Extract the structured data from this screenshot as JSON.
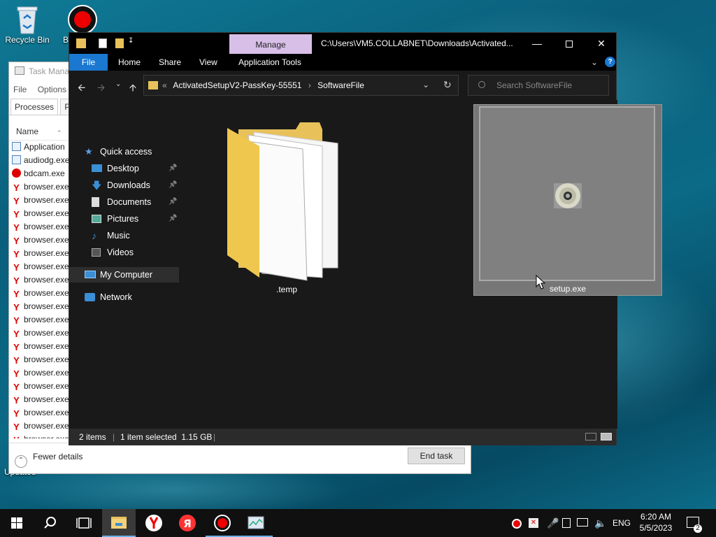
{
  "desktop": {
    "icons": [
      {
        "label": "Recycle Bin"
      },
      {
        "label": "B"
      }
    ],
    "bottom_text": "Updated"
  },
  "task_manager": {
    "title": "Task Manag",
    "menu": [
      "File",
      "Options"
    ],
    "tabs": [
      "Processes",
      "Pe"
    ],
    "column_name": "Name",
    "rows": [
      {
        "name": "Application",
        "icon": "app-icon"
      },
      {
        "name": "audiodg.exe",
        "icon": "app-icon"
      },
      {
        "name": "bdcam.exe",
        "icon": "record-icon"
      },
      {
        "name": "browser.exe",
        "icon": "yandex-icon"
      },
      {
        "name": "browser.exe",
        "icon": "yandex-icon"
      },
      {
        "name": "browser.exe",
        "icon": "yandex-icon"
      },
      {
        "name": "browser.exe",
        "icon": "yandex-icon"
      },
      {
        "name": "browser.exe",
        "icon": "yandex-icon"
      },
      {
        "name": "browser.exe",
        "icon": "yandex-icon"
      },
      {
        "name": "browser.exe",
        "icon": "yandex-icon"
      },
      {
        "name": "browser.exe",
        "icon": "yandex-icon"
      },
      {
        "name": "browser.exe",
        "icon": "yandex-icon"
      },
      {
        "name": "browser.exe",
        "icon": "yandex-icon"
      },
      {
        "name": "browser.exe",
        "icon": "yandex-icon"
      },
      {
        "name": "browser.exe",
        "icon": "yandex-icon"
      },
      {
        "name": "browser.exe",
        "icon": "yandex-icon"
      },
      {
        "name": "browser.exe",
        "icon": "yandex-icon"
      },
      {
        "name": "browser.exe",
        "icon": "yandex-icon"
      },
      {
        "name": "browser.exe",
        "icon": "yandex-icon"
      },
      {
        "name": "browser.exe",
        "icon": "yandex-icon"
      },
      {
        "name": "browser.exe",
        "icon": "yandex-icon"
      },
      {
        "name": "browser.exe",
        "icon": "yandex-icon"
      },
      {
        "name": "browser.exe",
        "icon": "yandex-icon"
      }
    ],
    "fewer_details": "Fewer details",
    "end_task": "End task"
  },
  "explorer": {
    "manage_tab": "Manage",
    "title_path": "C:\\Users\\VM5.COLLABNET\\Downloads\\Activated...",
    "ribbon": [
      "File",
      "Home",
      "Share",
      "View",
      "Application Tools"
    ],
    "address": {
      "prefix": "«",
      "crumbs": [
        "ActivatedSetupV2-PassKey-55551",
        "SoftwareFile"
      ]
    },
    "search_placeholder": "Search SoftwareFile",
    "nav": [
      {
        "label": "Quick access",
        "icon": "star-icon",
        "pinned": false
      },
      {
        "label": "Desktop",
        "icon": "desktop-icon",
        "pinned": true
      },
      {
        "label": "Downloads",
        "icon": "download-icon",
        "pinned": true
      },
      {
        "label": "Documents",
        "icon": "documents-icon",
        "pinned": true
      },
      {
        "label": "Pictures",
        "icon": "pictures-icon",
        "pinned": true
      },
      {
        "label": "Music",
        "icon": "music-icon",
        "pinned": false
      },
      {
        "label": "Videos",
        "icon": "videos-icon",
        "pinned": false
      },
      {
        "label": "My Computer",
        "icon": "computer-icon",
        "pinned": false
      },
      {
        "label": "Network",
        "icon": "network-icon",
        "pinned": false
      }
    ],
    "items": [
      {
        "name": ".temp",
        "icon": "folder-icon"
      },
      {
        "name": "setup.exe",
        "icon": "disc-icon"
      }
    ],
    "status": {
      "count": "2 items",
      "selection": "1 item selected  1.15 GB"
    }
  },
  "taskbar": {
    "language": "ENG",
    "time": "6:20 AM",
    "date": "5/5/2023",
    "notifications": "2"
  },
  "colors": {
    "explorer_bg": "#191919",
    "manage_tab": "#d8bfe8",
    "file_tab": "#1a78d0",
    "folder": "#e8c15a"
  }
}
